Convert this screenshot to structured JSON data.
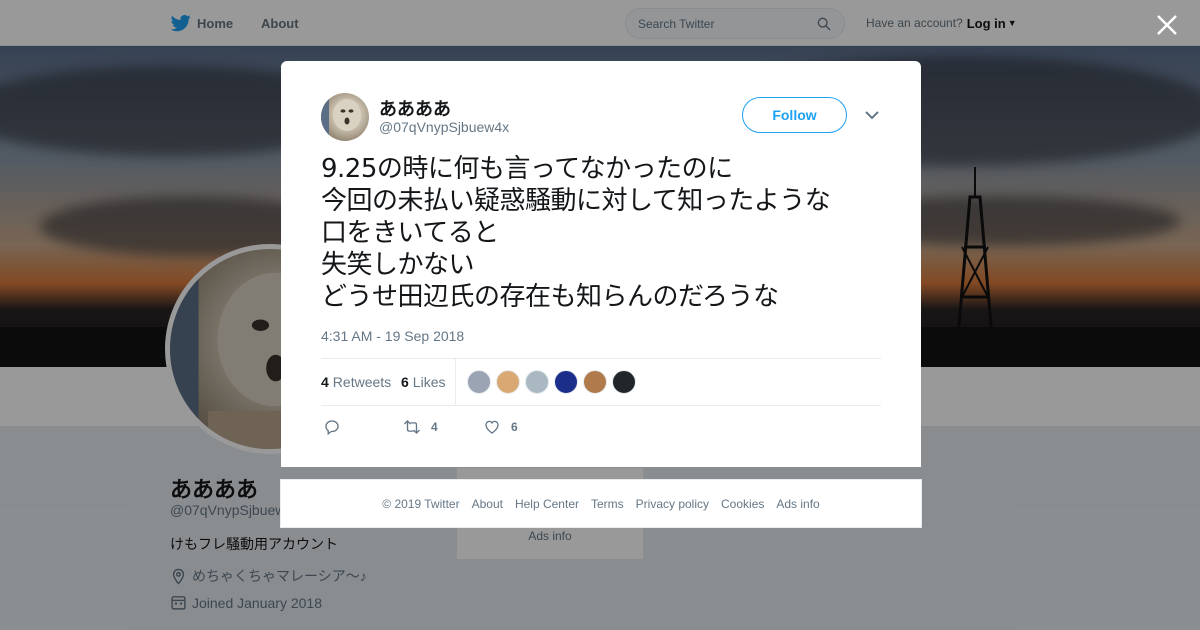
{
  "topbar": {
    "home_label": "Home",
    "about_label": "About",
    "search_placeholder": "Search Twitter",
    "have_account": "Have an account?",
    "login_label": "Log in"
  },
  "profile": {
    "name": "ああああ",
    "handle": "@07qVnypSjbuew4x",
    "bio": "けもフレ騒動用アカウント",
    "location": "めちゃくちゃマレーシア～♪",
    "joined": "Joined January 2018"
  },
  "side_card": {
    "ads": "Ads info"
  },
  "tweet": {
    "author_name": "ああああ",
    "author_handle": "@07qVnypSjbuew4x",
    "follow_label": "Follow",
    "lines": [
      "9.25の時に何も言ってなかったのに",
      "今回の未払い疑惑騒動に対して知ったような",
      "口をきいてると",
      "失笑しかない",
      "どうせ田辺氏の存在も知らんのだろうな"
    ],
    "timestamp": "4:31 AM - 19 Sep 2018",
    "retweets_count": "4",
    "retweets_label": "Retweets",
    "likes_count": "6",
    "likes_label": "Likes",
    "action_retweet_count": "4",
    "action_like_count": "6",
    "liker_colors": [
      "#9aa4b2",
      "#d9a873",
      "#aab8c2",
      "#1b2f8a",
      "#b07a4a",
      "#22262b"
    ]
  },
  "footer": {
    "items": [
      "© 2019 Twitter",
      "About",
      "Help Center",
      "Terms",
      "Privacy policy",
      "Cookies",
      "Ads info"
    ]
  },
  "colors": {
    "accent": "#1da1f2",
    "muted": "#657786"
  }
}
